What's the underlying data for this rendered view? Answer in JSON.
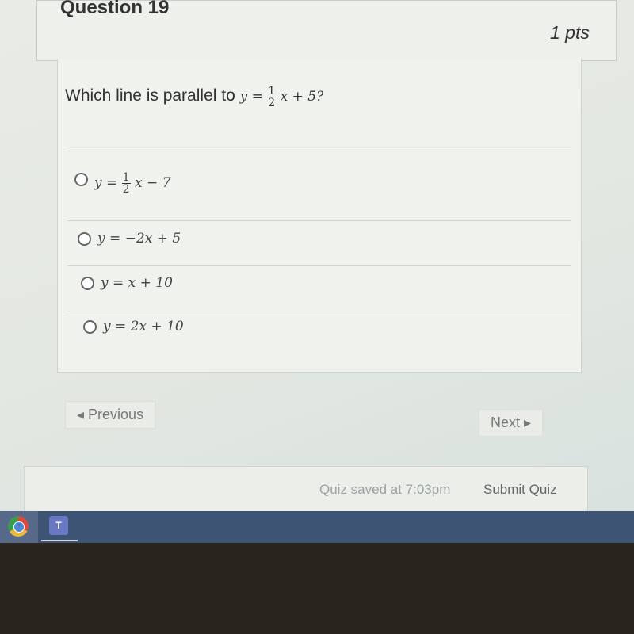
{
  "question": {
    "title": "Question 19",
    "points": "1 pts",
    "prompt": "Which line is parallel to",
    "equation": {
      "lhs": "y =",
      "num": "1",
      "den": "2",
      "rest": "x + 5",
      "suffix": "?"
    }
  },
  "answers": [
    {
      "lhs": "y =",
      "num": "1",
      "den": "2",
      "rest": "x − 7",
      "selected": false
    },
    {
      "text": "y = −2x + 5",
      "selected": false
    },
    {
      "text": "y = x + 10",
      "selected": false
    },
    {
      "text": "y = 2x + 10",
      "selected": false
    }
  ],
  "nav": {
    "previous": "◂ Previous",
    "next": "Next ▸"
  },
  "footer": {
    "saved": "Quiz saved at 7:03pm",
    "submit": "Submit Quiz"
  },
  "taskbar": {
    "apps": [
      "chrome-icon",
      "teams-icon"
    ],
    "teams_letter": "T"
  }
}
